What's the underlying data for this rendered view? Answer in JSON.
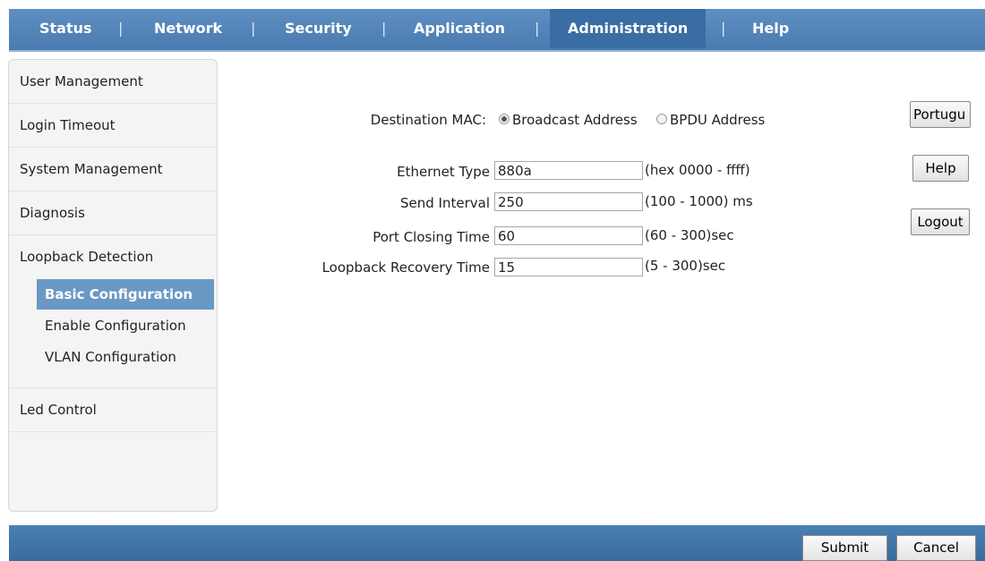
{
  "nav": {
    "items": [
      "Status",
      "Network",
      "Security",
      "Application",
      "Administration",
      "Help"
    ],
    "active": "Administration",
    "separator": "|"
  },
  "sidebar": {
    "items": [
      "User Management",
      "Login Timeout",
      "System Management",
      "Diagnosis",
      "Loopback Detection"
    ],
    "subitems": [
      "Basic Configuration",
      "Enable Configuration",
      "VLAN Configuration"
    ],
    "active_subitem": "Basic Configuration",
    "bottom_item": "Led Control"
  },
  "form": {
    "destination_mac_label": "Destination MAC:",
    "mac_options": [
      "Broadcast Address",
      "BPDU Address"
    ],
    "mac_selected": "Broadcast Address",
    "ethernet_type": {
      "label": "Ethernet Type",
      "value": "880a",
      "hint": "(hex 0000 - ffff)"
    },
    "send_interval": {
      "label": "Send Interval",
      "value": "250",
      "hint": "(100 - 1000) ms"
    },
    "port_closing_time": {
      "label": "Port Closing Time",
      "value": "60",
      "hint": "(60 - 300)sec"
    },
    "loopback_recovery_time": {
      "label": "Loopback Recovery Time",
      "value": "15",
      "hint": "(5 - 300)sec"
    }
  },
  "side_buttons": {
    "language": "Portugu",
    "help": "Help",
    "logout": "Logout"
  },
  "footer": {
    "submit": "Submit",
    "cancel": "Cancel"
  },
  "colors": {
    "nav_bg": "#4a7bb0",
    "nav_active": "#3a6da3",
    "sidebar_active": "#6a98c4",
    "footer_bg": "#3a6c9d"
  }
}
